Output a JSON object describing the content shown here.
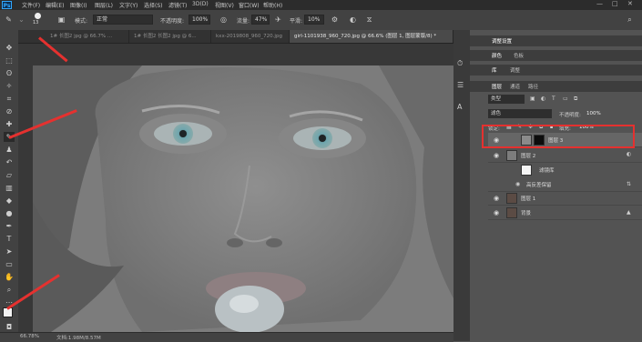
{
  "app": {
    "logo": "Ps"
  },
  "menu": [
    "文件(F)",
    "编辑(E)",
    "图像(I)",
    "图层(L)",
    "文字(Y)",
    "选择(S)",
    "滤镜(T)",
    "3D(D)",
    "视图(V)",
    "窗口(W)",
    "帮助(H)"
  ],
  "window_buttons": [
    "—",
    "□",
    "✕"
  ],
  "options": {
    "brush_size": "13",
    "mode_label": "模式:",
    "mode_value": "正常",
    "opacity_label": "不透明度:",
    "opacity_value": "100%",
    "flow_label": "流量:",
    "flow_value": "47%",
    "smooth_label": "平滑:",
    "smooth_value": "10%"
  },
  "tabs": [
    {
      "label": "1# 长图2 jpg @ 66.7% ..."
    },
    {
      "label": "1# 长图2 长图2 jpg @ 6..."
    },
    {
      "label": "kxx-2019808_960_720.jpg"
    },
    {
      "label": "girl-1101938_960_720.jpg @ 66.6% (图层 1, 图层蒙版/8) *",
      "active": true
    }
  ],
  "status": {
    "zoom": "66.78%",
    "doc": "文档:1.98M/8.57M"
  },
  "panels": {
    "top_tabs": [
      "调整设置"
    ],
    "color_tabs": [
      "颜色",
      "色板"
    ],
    "lib_tabs": [
      "库",
      "调整"
    ],
    "layer_tabs": [
      "图层",
      "通道",
      "路径"
    ],
    "kind_label": "类型",
    "blend_mode": "滤色",
    "opacity_label": "不透明度:",
    "opacity_value": "100%",
    "lock_label": "锁定:",
    "fill_label": "填充:",
    "fill_value": "100%",
    "layers": [
      {
        "name": "图层 3",
        "highlighted": true
      },
      {
        "name": "图层 2"
      },
      {
        "name": "滤镜库"
      },
      {
        "name": "高反差保留"
      },
      {
        "name": "图层 1"
      },
      {
        "name": "背景"
      }
    ]
  },
  "colors": {
    "highlight": "#e5312f",
    "accent": "#31a8ff"
  }
}
